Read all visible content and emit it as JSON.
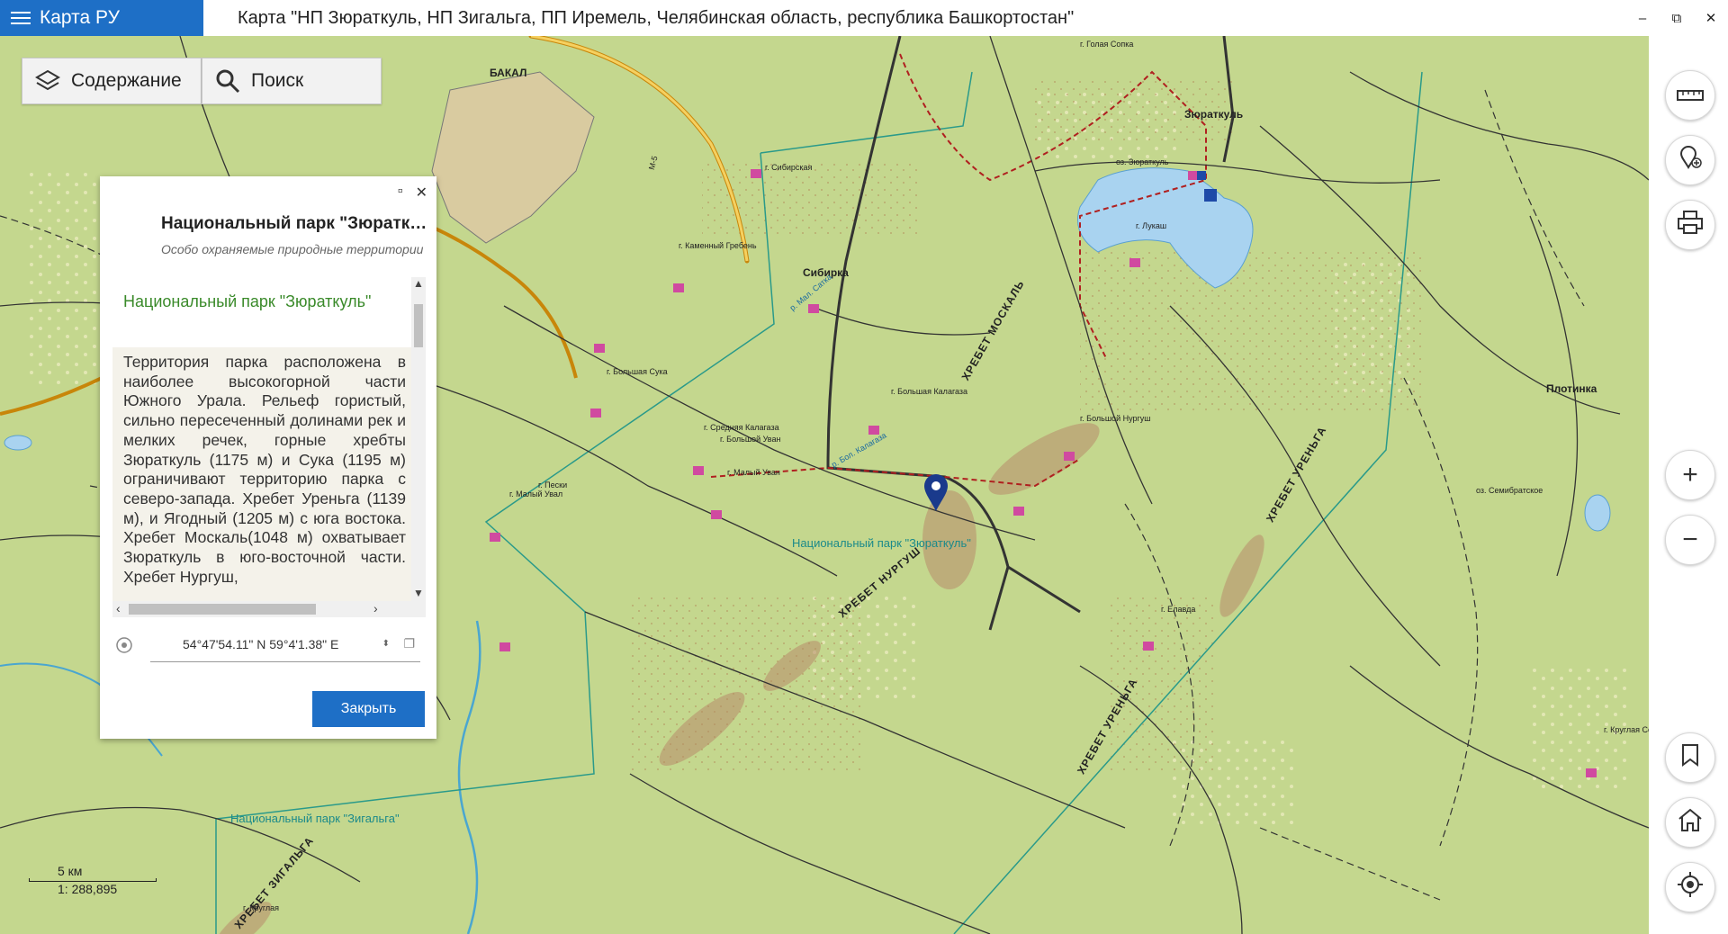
{
  "titlebar": {
    "app_name": "Карта РУ",
    "window_title": "Карта \"НП Зюраткуль, НП Зигальга, ПП Иремель, Челябинская область, республика Башкортостан\"",
    "minimize": "–",
    "restore": "⧉",
    "close": "✕"
  },
  "toolbar": {
    "contents_label": "Содержание",
    "search_label": "Поиск"
  },
  "panel": {
    "title": "Национальный парк \"Зюраткуль\"",
    "subtitle": "Особо охраняемые природные территории",
    "feature_name": "Национальный парк \"Зюраткуль\"",
    "description": "Территория парка расположена в наиболее высокогорной части Южного Урала. Рельеф гористый, сильно пересеченный долинами рек и мелких речек, горные хребты Зюраткуль (1175 м) и Сука (1195 м) ограничивают территорию парка с северо-запада. Хребет Уреньга (1139 м), и Ягодный (1205 м) с юга востока. Хребет Москаль(1048 м) охватывает Зюраткуль в юго-восточной части. Хребет Нургуш,",
    "coordinates": "54°47'54.11\" N 59°4'1.38\" E",
    "close_button": "Закрыть"
  },
  "map": {
    "labels": {
      "bakal": "БАКАЛ",
      "zuratkul": "Зюраткуль",
      "sibirka": "Сибирка",
      "plotinka": "Плотинка",
      "golaya_sopka": "г. Голая Сопка",
      "oz_zuratkul": "оз. Зюраткуль",
      "lukash": "г. Лукаш",
      "sibirskaya": "г. Сибирская",
      "kamenny_greben": "г. Каменный Гребень",
      "bolshaya_suka": "г. Большая Сука",
      "bolshaya_kalagaza": "г. Большая Калагаза",
      "srednyaya_kalagaza": "г. Средняя Калагаза",
      "bolshoy_uvan": "г. Большой Уван",
      "maly_uvan": "г. Малый Уван",
      "peski": "г. Пески",
      "maly_uval": "г. Малый Увал",
      "bolshoy_nurgush": "г. Большой Нургуш",
      "elavda": "г. Елавда",
      "kruglaya_sopka": "г. Круглая Сопка",
      "kruglaya": "г. Круглая",
      "oz_semibratskoe": "оз. Семибратское",
      "m5": "М-5",
      "r_bol_kalagaza": "р. Бол. Калагаза",
      "r_mal_satka": "р. Мал. Сатка",
      "park_zuratkul": "Национальный парк \"Зюраткуль\"",
      "park_zigalga": "Национальный парк \"Зигальга\"",
      "ridge_moskal": "ХРЕБЕТ МОСКАЛЬ",
      "ridge_nurgush": "ХРЕБЕТ НУРГУШ",
      "ridge_urenga_1": "ХРЕБЕТ УРЕНЬГА",
      "ridge_urenga_2": "ХРЕБЕТ УРЕНЬГА",
      "ridge_zigalga": "ХРЕБЕТ ЗИГАЛЬГА"
    }
  },
  "scale": {
    "distance": "5 км",
    "ratio": "1: 288,895"
  },
  "icons": {
    "ruler": "ruler-icon",
    "add_place": "add-place-icon",
    "print": "print-icon",
    "zoom_in": "plus-icon",
    "zoom_out": "minus-icon",
    "bookmark": "bookmark-icon",
    "home": "home-icon",
    "locate": "locate-icon"
  },
  "colors": {
    "accent": "#1e6fc6",
    "map_base": "#c5d890",
    "park_label": "#1b8a8a",
    "feature_name": "#3a8a2a"
  }
}
